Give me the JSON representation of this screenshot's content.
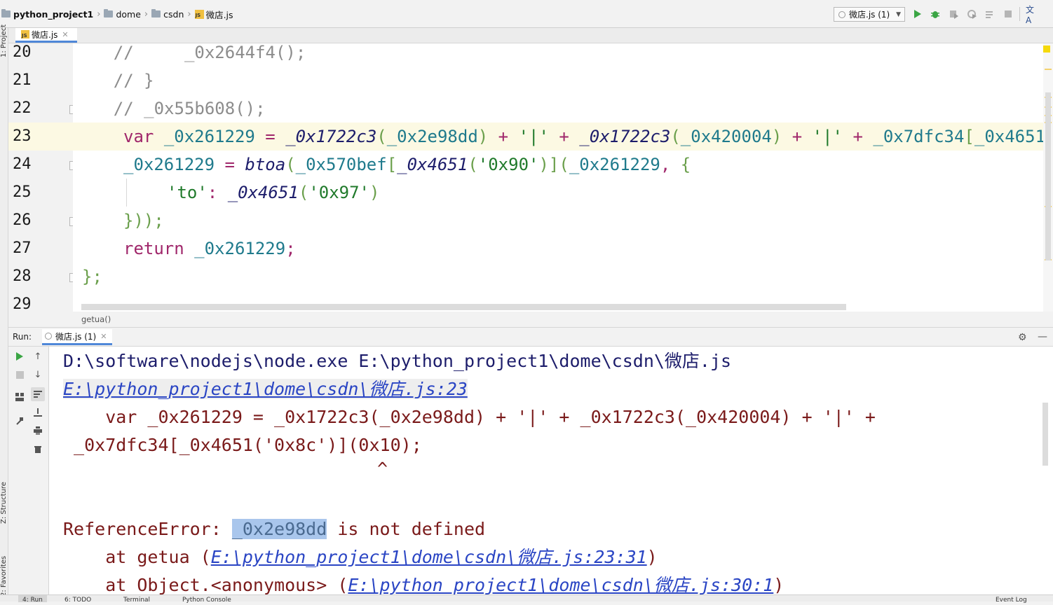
{
  "navbar": {
    "breadcrumbs": [
      "python_project1",
      "dome",
      "csdn",
      "微店.js"
    ],
    "run_config": "微店.js (1)"
  },
  "side": {
    "project": "1: Project",
    "structure": "Z: Structure",
    "favorites": "2: Favorites"
  },
  "editor": {
    "tab": "微店.js",
    "line_numbers": [
      "20",
      "21",
      "22",
      "23",
      "24",
      "25",
      "26",
      "27",
      "28",
      "29"
    ],
    "breadcrumb": "getua()",
    "line20": {
      "pre": "    ",
      "text": "//     _0x2644f4();"
    },
    "line21": {
      "pre": "    ",
      "text": "// }"
    },
    "line22": {
      "pre": "    ",
      "text": "// _0x55b608();"
    },
    "line23": {
      "kw": "var",
      "v1": "_0x261229",
      "eq": " = ",
      "f1": "_0x1722c3",
      "p1": "(",
      "a1": "_0x2e98dd",
      "p2": ")",
      "plus1": " + ",
      "s1": "'|'",
      "plus2": " + ",
      "f2": "_0x1722c3",
      "p3": "(",
      "a2": "_0x420004",
      "p4": ")",
      "plus3": " + ",
      "s2": "'|'",
      "plus4": " + ",
      "a3": "_0x7dfc34",
      "p5": "[",
      "a4": "_0x4651"
    },
    "line24": {
      "v": "_0x261229",
      "eq": " = ",
      "f": "btoa",
      "p1": "(",
      "a1": "_0x570bef",
      "b1": "[",
      "f2": "_0x4651",
      "p2": "(",
      "s1": "'0x90'",
      "p3": ")",
      "b2": "]",
      "p4": "(",
      "a2": "_0x261229",
      "c": ", ",
      "brace": "{"
    },
    "line25": {
      "k": "'to'",
      "colon": ": ",
      "f": "_0x4651",
      "p1": "(",
      "s": "'0x97'",
      "p2": ")"
    },
    "line26": {
      "text": "}));"
    },
    "line27": {
      "kw": "return",
      "sp": " ",
      "v": "_0x261229",
      "semi": ";"
    },
    "line28": {
      "text": "};"
    }
  },
  "run": {
    "label": "Run:",
    "tab": "微店.js (1)",
    "console": {
      "cmd": "D:\\software\\nodejs\\node.exe E:\\python_project1\\dome\\csdn\\微店.js",
      "loc": "E:\\python_project1\\dome\\csdn\\微店.js:23",
      "code1": "    var _0x261229 = _0x1722c3(_0x2e98dd) + '|' + _0x1722c3(_0x420004) + '|' +",
      "code2": " _0x7dfc34[_0x4651('0x8c')](0x10);",
      "caret": "^",
      "err_prefix": "ReferenceError: ",
      "err_selected": "_0x2e98dd",
      "err_suffix": " is not defined",
      "at1_prefix": "    at getua (",
      "at1_link": "E:\\python_project1\\dome\\csdn\\微店.js:23:31",
      "at1_suffix": ")",
      "at2_prefix": "    at Object.<anonymous> (",
      "at2_link": "E:\\python_project1\\dome\\csdn\\微店.js:30:1",
      "at2_suffix": ")"
    }
  },
  "statusbar": {
    "run": "4: Run",
    "todo": "6: TODO",
    "terminal": "Terminal",
    "python_console": "Python Console",
    "event_log": "Event Log"
  },
  "colors": {
    "run_green": "#3aa544",
    "accent_blue": "#4f87d8",
    "current_line": "#fcf9e3"
  }
}
